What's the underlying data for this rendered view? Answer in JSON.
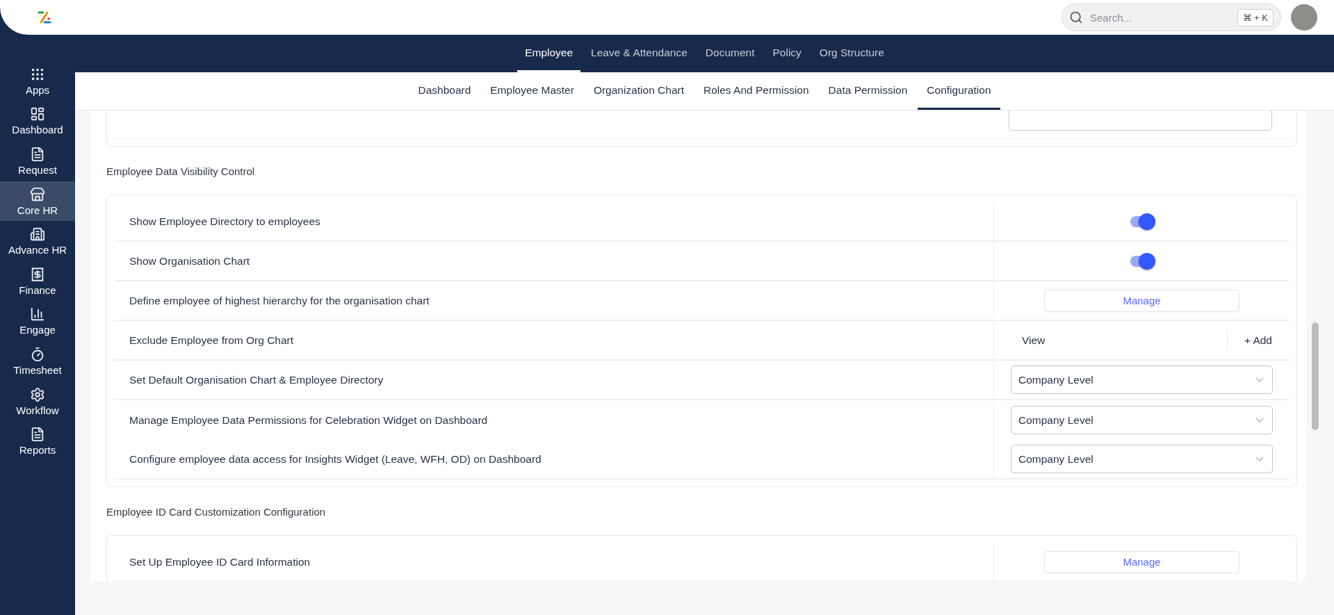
{
  "top_bar": {
    "search": {
      "placeholder": "Search...",
      "shortcut": "⌘ + K"
    }
  },
  "main_nav": [
    {
      "label": "Employee",
      "selected": true
    },
    {
      "label": "Leave & Attendance",
      "selected": false
    },
    {
      "label": "Document",
      "selected": false
    },
    {
      "label": "Policy",
      "selected": false
    },
    {
      "label": "Org Structure",
      "selected": false
    }
  ],
  "sidebar": {
    "items": [
      {
        "label": "Apps",
        "selected": false
      },
      {
        "label": "Dashboard",
        "selected": false
      },
      {
        "label": "Request",
        "selected": false
      },
      {
        "label": "Core HR",
        "selected": true
      },
      {
        "label": "Advance HR",
        "selected": false
      },
      {
        "label": "Finance",
        "selected": false
      },
      {
        "label": "Engage",
        "selected": false
      },
      {
        "label": "Timesheet",
        "selected": false
      },
      {
        "label": "Workflow",
        "selected": false
      },
      {
        "label": "Reports",
        "selected": false
      }
    ]
  },
  "sub_nav": [
    {
      "label": "Dashboard",
      "selected": false
    },
    {
      "label": "Employee Master",
      "selected": false
    },
    {
      "label": "Organization Chart",
      "selected": false
    },
    {
      "label": "Roles And Permission",
      "selected": false
    },
    {
      "label": "Data Permission",
      "selected": false
    },
    {
      "label": "Configuration",
      "selected": true
    }
  ],
  "sections": [
    {
      "title": "Employee Data Visibility Control",
      "rows": [
        {
          "kind": "toggle",
          "label": "Show Employee Directory to employees",
          "on": true
        },
        {
          "kind": "toggle",
          "label": "Show Organisation Chart",
          "on": true
        },
        {
          "kind": "button",
          "label": "Define employee of highest hierarchy for the organisation chart",
          "button": "Manage"
        },
        {
          "kind": "view_add",
          "label": "Exclude Employee from Org Chart",
          "view": "View",
          "add": "+ Add"
        },
        {
          "kind": "select",
          "label": "Set Default Organisation Chart & Employee Directory",
          "value": "Company Level"
        },
        {
          "kind": "select",
          "label": "Manage Employee Data Permissions for Celebration Widget on Dashboard",
          "value": "Company Level"
        },
        {
          "kind": "select",
          "label": "Configure employee data access for Insights Widget (Leave, WFH, OD) on Dashboard",
          "value": "Company Level"
        }
      ]
    },
    {
      "title": "Employee ID Card Customization Configuration",
      "rows": [
        {
          "kind": "button",
          "label": "Set Up Employee ID Card Information",
          "button": "Manage"
        }
      ]
    }
  ]
}
